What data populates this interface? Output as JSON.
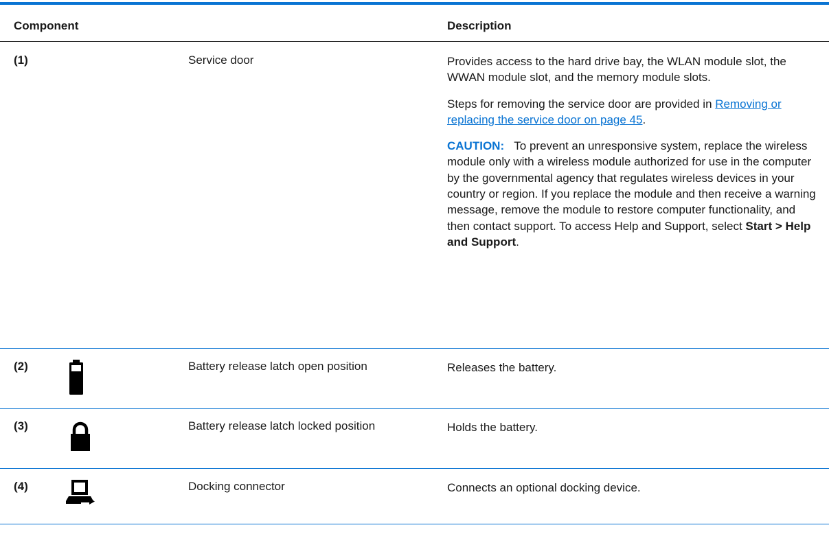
{
  "header": {
    "component": "Component",
    "description": "Description"
  },
  "rows": [
    {
      "num": "(1)",
      "name": "Service door",
      "icon": "",
      "desc_p1": "Provides access to the hard drive bay, the WLAN module slot, the WWAN module slot, and the memory module slots.",
      "desc_p2_text": "Steps for removing the service door are provided in ",
      "desc_p2_link": "Removing or replacing the service door on page 45",
      "desc_p2_end": ".",
      "caution_label": "CAUTION:",
      "caution_text": "To prevent an unresponsive system, replace the wireless module only with a wireless module authorized for use in the computer by the governmental agency that regulates wireless devices in your country or region. If you replace the module and then receive a warning message, remove the module to restore computer functionality, and then contact support. To access Help and Support, select ",
      "caution_bold": "Start > Help and Support",
      "caution_end": "."
    },
    {
      "num": "(2)",
      "name": "Battery release latch open position",
      "icon": "battery-icon",
      "desc": "Releases the battery."
    },
    {
      "num": "(3)",
      "name": "Battery release latch locked position",
      "icon": "padlock-icon",
      "desc": "Holds the battery."
    },
    {
      "num": "(4)",
      "name": "Docking connector",
      "icon": "docking-computer-icon",
      "desc": "Connects an optional docking device."
    }
  ],
  "colors": {
    "accent": "#0a74d3",
    "text": "#1a1a1a"
  }
}
